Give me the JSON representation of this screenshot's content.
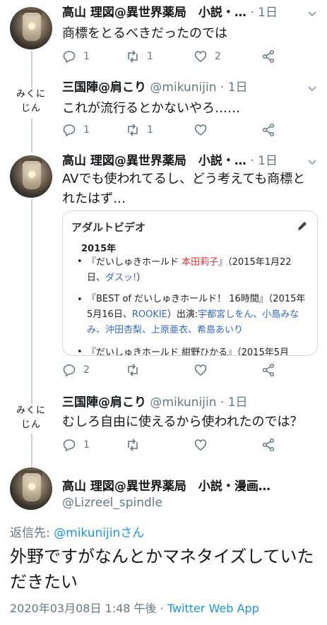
{
  "tweets": [
    {
      "name": "高山 理図@異世界薬局　小説・…",
      "handle": "",
      "time": "1日",
      "text": "商標をとるべきだったのでは",
      "reply_count": "1",
      "retweet_count": "1",
      "like_count": "2"
    },
    {
      "avatar_text": "みくにじん",
      "avatar_line1": "みくに",
      "avatar_line2": "じん",
      "name": "三国陣@肩こり",
      "handle": "@mikunijin",
      "time": "1日",
      "text": "これが流行るとかないやろ……",
      "reply_count": "1",
      "retweet_count": "1",
      "like_count": ""
    },
    {
      "name": "高山 理図@異世界薬局　小説・…",
      "handle": "",
      "time": "1日",
      "text": "AVでも使われてるし、どう考えても商標とれたはず…",
      "reply_count": "2",
      "retweet_count": "",
      "like_count": ""
    },
    {
      "avatar_line1": "みくに",
      "avatar_line2": "じん",
      "name": "三国陣@肩こり",
      "handle": "@mikunijin",
      "time": "1日",
      "text": "むしろ自由に使えるから使われたのでは？",
      "reply_count": "1",
      "retweet_count": "",
      "like_count": ""
    }
  ],
  "card": {
    "title": "アダルトビデオ",
    "year": "2015年",
    "item1_title": "『だいしゅきホールド 本田莉子』（2015年1月22日、ダスッ!）",
    "item1_a": "『だいしゅきホールド ",
    "item1_red": "本田莉子",
    "item1_b": "』（2015年1月22日、",
    "item1_link": "ダスッ!",
    "item1_c": "）",
    "item2_a": "『BEST of だいしゅきホールド！ 16時間』（2015年5月16日、",
    "item2_link": "ROOKIE",
    "item2_b": "）出演:",
    "item2_cast": "宇都宮しをん、小島みなみ、沖田杏梨、上原亜衣、希島あいり",
    "item3": "『だいしゅきホールド 紺野ひかる』（2015年5月"
  },
  "detail": {
    "name": "高山 理図@異世界薬局　小説・漫画…",
    "handle": "@Lizreel_spindle",
    "reply_label": "返信先: ",
    "reply_to": "@mikunijinさん",
    "text": "外野ですがなんとかマネタイズしていただきたい",
    "timestamp": "2020年03月08日 1:48 午後",
    "dot": " · ",
    "app": "Twitter Web App"
  },
  "colors": {
    "link": "#1b95e0",
    "muted": "#657786",
    "text": "#14171a",
    "divider": "#e6ecf0"
  },
  "icons": [
    "reply-icon",
    "retweet-icon",
    "like-icon",
    "share-icon",
    "chevron-down-icon",
    "edit-icon"
  ]
}
